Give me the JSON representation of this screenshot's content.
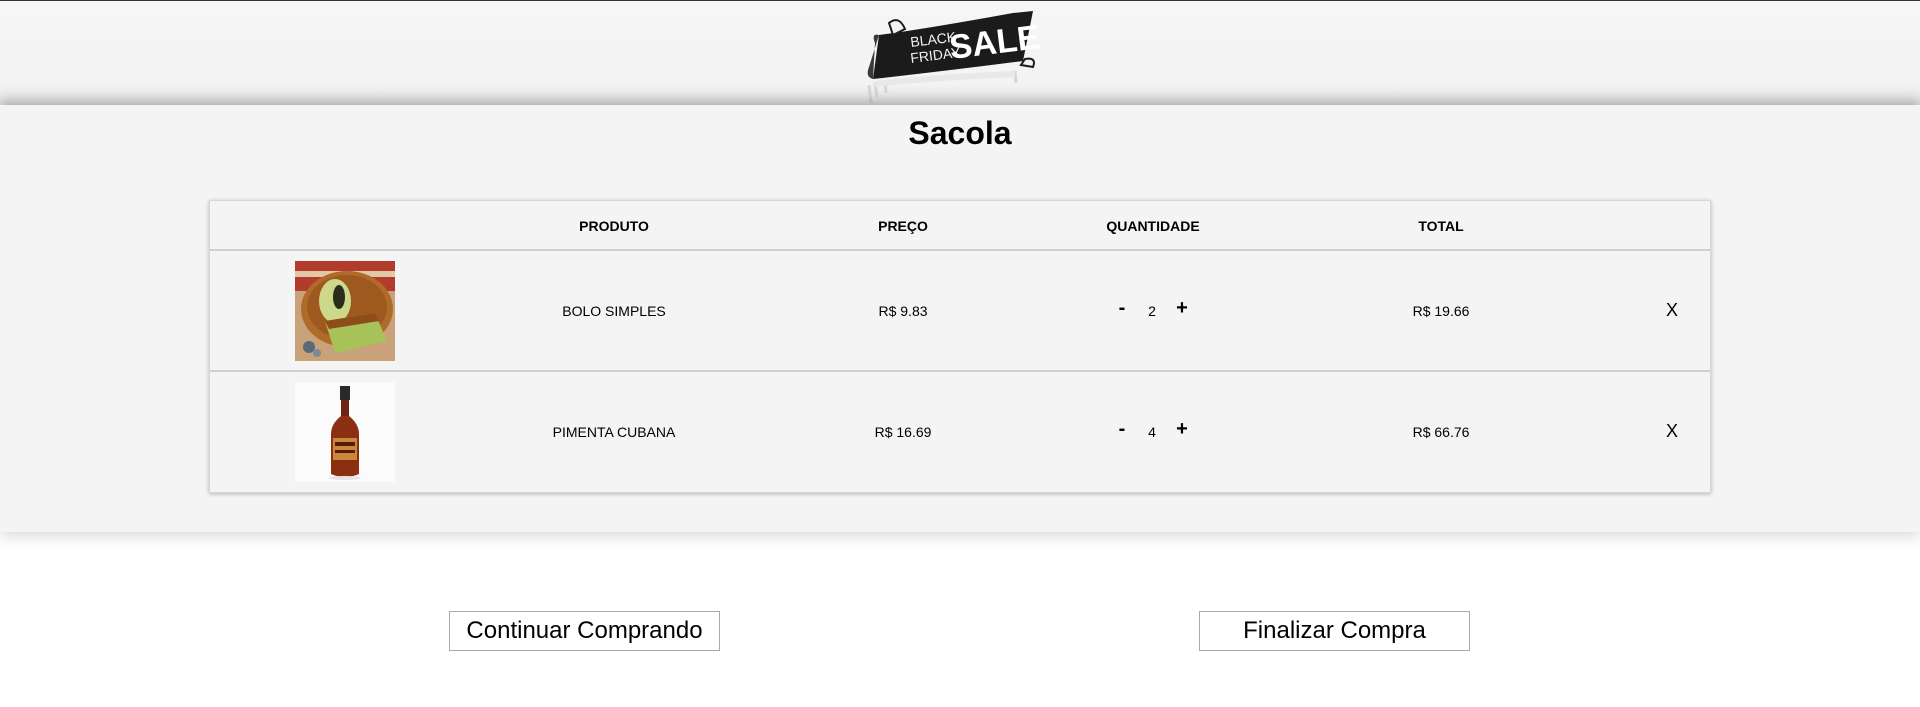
{
  "header": {
    "logo": {
      "line1": "BLACK",
      "line2": "FRIDAY",
      "word": "SALE"
    }
  },
  "cart": {
    "title": "Sacola",
    "columns": {
      "produto": "PRODUTO",
      "preco": "PREÇO",
      "quantidade": "QUANTIDADE",
      "total": "TOTAL"
    },
    "items": [
      {
        "image": "cake-photo",
        "name": "BOLO SIMPLES",
        "price": "R$ 9.83",
        "qty": "2",
        "total": "R$ 19.66",
        "minus": "-",
        "plus": "+",
        "remove": "X"
      },
      {
        "image": "hot-sauce-bottle-photo",
        "name": "PIMENTA CUBANA",
        "price": "R$ 16.69",
        "qty": "4",
        "total": "R$ 66.76",
        "minus": "-",
        "plus": "+",
        "remove": "X"
      }
    ]
  },
  "actions": {
    "continue_label": "Continuar Comprando",
    "finish_label": "Finalizar Compra"
  },
  "colors": {
    "panel_bg": "#f4f4f4",
    "logo_dark": "#1b1b1b"
  }
}
